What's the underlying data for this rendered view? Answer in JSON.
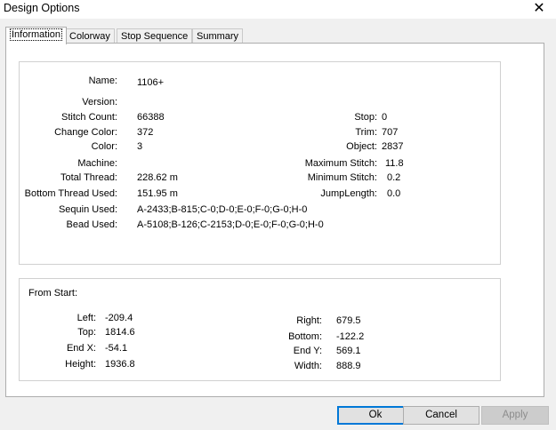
{
  "window": {
    "title": "Design Options",
    "close_glyph": "✕"
  },
  "tabs": [
    "Information",
    "Colorway",
    "Stop Sequence",
    "Summary"
  ],
  "info": {
    "name": {
      "label": "Name:",
      "value": "1106+"
    },
    "version": {
      "label": "Version:",
      "value": ""
    },
    "stitch_count": {
      "label": "Stitch Count:",
      "value": "66388"
    },
    "change_color": {
      "label": "Change Color:",
      "value": "372"
    },
    "color": {
      "label": "Color:",
      "value": "3"
    },
    "machine": {
      "label": "Machine:",
      "value": ""
    },
    "total_thread": {
      "label": "Total Thread:",
      "value": "228.62 m"
    },
    "bottom_thread": {
      "label": "Bottom Thread Used:",
      "value": "151.95 m"
    },
    "sequin": {
      "label": "Sequin Used:",
      "value": "A-2433;B-815;C-0;D-0;E-0;F-0;G-0;H-0"
    },
    "bead": {
      "label": "Bead Used:",
      "value": "A-5108;B-126;C-2153;D-0;E-0;F-0;G-0;H-0"
    },
    "stop": {
      "label": "Stop:",
      "value": "0"
    },
    "trim": {
      "label": "Trim:",
      "value": "707"
    },
    "object": {
      "label": "Object:",
      "value": "2837"
    },
    "max_stitch": {
      "label": "Maximum Stitch:",
      "value": "11.8"
    },
    "min_stitch": {
      "label": "Minimum Stitch:",
      "value": "0.2"
    },
    "jump_length": {
      "label": "JumpLength:",
      "value": "0.0"
    }
  },
  "from_start": {
    "heading": "From Start:",
    "left": {
      "label": "Left:",
      "value": "-209.4"
    },
    "top": {
      "label": "Top:",
      "value": "1814.6"
    },
    "end_x": {
      "label": "End X:",
      "value": "-54.1"
    },
    "height": {
      "label": "Height:",
      "value": "1936.8"
    },
    "right": {
      "label": "Right:",
      "value": "679.5"
    },
    "bottom": {
      "label": "Bottom:",
      "value": "-122.2"
    },
    "end_y": {
      "label": "End Y:",
      "value": "569.1"
    },
    "width": {
      "label": "Width:",
      "value": "888.9"
    }
  },
  "buttons": {
    "ok": "Ok",
    "cancel": "Cancel",
    "apply": "Apply"
  }
}
